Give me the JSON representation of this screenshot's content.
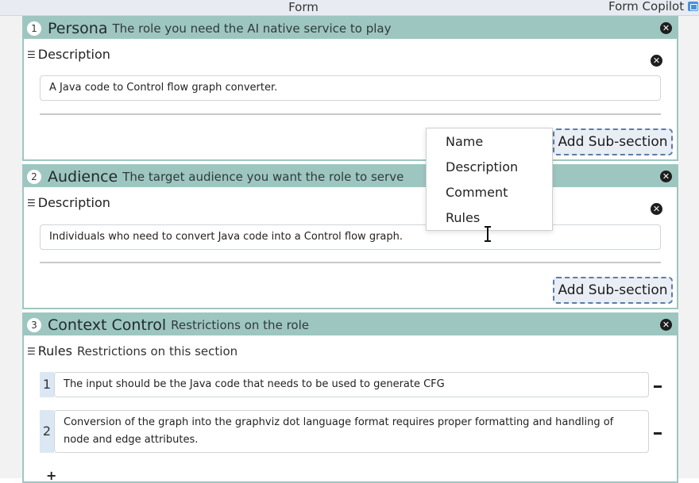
{
  "topbar": {
    "form_title": "Form",
    "copilot_label": "Form Copilot"
  },
  "sections": [
    {
      "number": "1",
      "title": "Persona",
      "subtitle": "The role you need the AI native service to play",
      "field_label": "Description",
      "field_value": "A Java code to Control flow graph converter.",
      "add_label": "Add Sub-section"
    },
    {
      "number": "2",
      "title": "Audience",
      "subtitle": "The target audience you want the role to serve",
      "field_label": "Description",
      "field_value": "Individuals who need to convert Java code into a Control flow graph.",
      "add_label": "Add Sub-section"
    },
    {
      "number": "3",
      "title": "Context Control",
      "subtitle": "Restrictions on the role",
      "field_label": "Rules",
      "field_subtitle": "Restrictions on this section",
      "rules": [
        {
          "num": "1",
          "text": "The input should be the Java code that needs to be used to generate CFG"
        },
        {
          "num": "2",
          "text": "Conversion of the graph into the graphviz dot language format requires proper formatting and handling of node and edge attributes."
        }
      ],
      "add_rule": "+"
    }
  ],
  "dropdown": {
    "options": [
      "Name",
      "Description",
      "Comment",
      "Rules"
    ]
  },
  "icons": {
    "close": "close-icon",
    "list": "list-icon",
    "minus": "remove-icon",
    "copilot": "copilot-icon"
  },
  "colors": {
    "section_header": "#9ec6c1",
    "add_button_border": "#5a7da8",
    "rule_number_bg": "#dbe8f3"
  }
}
